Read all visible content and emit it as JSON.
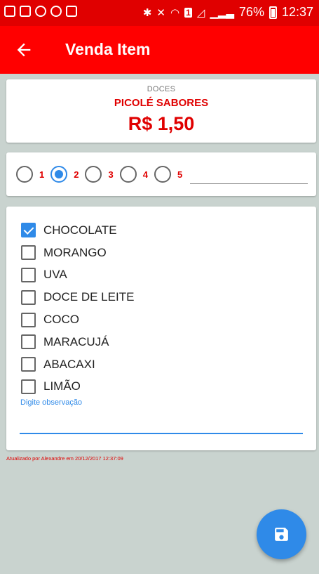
{
  "status_bar": {
    "battery_percent": "76%",
    "time": "12:37",
    "sim_label": "1"
  },
  "app_bar": {
    "title": "Venda Item",
    "back_icon": "arrow-back-icon"
  },
  "product": {
    "category": "DOCES",
    "name": "PICOLÉ SABORES",
    "price": "R$ 1,50"
  },
  "quantity": {
    "options": [
      "1",
      "2",
      "3",
      "4",
      "5"
    ],
    "selected": "2",
    "input_value": ""
  },
  "flavors": [
    {
      "label": "CHOCOLATE",
      "checked": true
    },
    {
      "label": "MORANGO",
      "checked": false
    },
    {
      "label": "UVA",
      "checked": false
    },
    {
      "label": "DOCE DE LEITE",
      "checked": false
    },
    {
      "label": "COCO",
      "checked": false
    },
    {
      "label": "MARACUJÁ",
      "checked": false
    },
    {
      "label": "ABACAXI",
      "checked": false
    },
    {
      "label": "LIMÃO",
      "checked": false
    }
  ],
  "observation": {
    "placeholder": "Digite observação",
    "value": ""
  },
  "footer": {
    "updated_text": "Atualizado por Alexandre em 20/12/2017 12:37:09"
  },
  "fab": {
    "icon": "save-icon"
  },
  "colors": {
    "status_bar": "#e00000",
    "app_bar": "#ff0000",
    "accent": "#2f8ae8",
    "price_text": "#e00000",
    "background": "#c9d3cf"
  }
}
